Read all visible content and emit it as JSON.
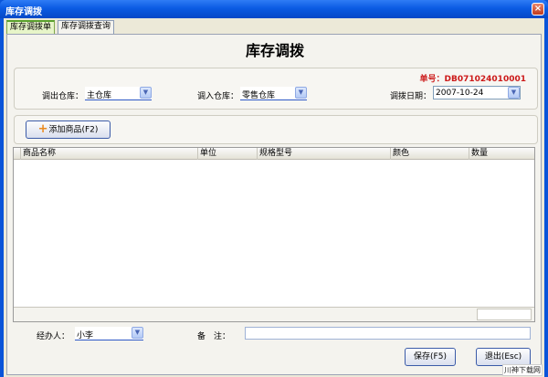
{
  "window": {
    "title": "库存调拨",
    "close_glyph": "×"
  },
  "tabs": [
    {
      "label": "库存调拨单",
      "active": true
    },
    {
      "label": "库存调拨查询",
      "active": false
    }
  ],
  "form": {
    "title": "库存调拨",
    "order_no": "单号：DB071024010001",
    "out_warehouse": {
      "label": "调出仓库：",
      "value": "主仓库"
    },
    "in_warehouse": {
      "label": "调入仓库：",
      "value": "零售仓库"
    },
    "transfer_date": {
      "label": "调拨日期：",
      "value": "2007-10-24"
    }
  },
  "toolbar": {
    "add_product_label": "添加商品(F2)",
    "add_icon": "plus-icon"
  },
  "grid": {
    "columns": [
      "商品名称",
      "单位",
      "规格型号",
      "颜色",
      "数量"
    ],
    "rows": []
  },
  "footer": {
    "handler": {
      "label": "经办人：",
      "value": "小李"
    },
    "remark": {
      "label": "备　注：",
      "value": ""
    },
    "save_label": "保存(F5)",
    "exit_label": "退出(Esc)"
  },
  "watermark": "川神下载网",
  "colors": {
    "titlebar": "#0b5be3",
    "order_no": "#cc1a1a",
    "accent_icon": "#ea8a1e"
  }
}
